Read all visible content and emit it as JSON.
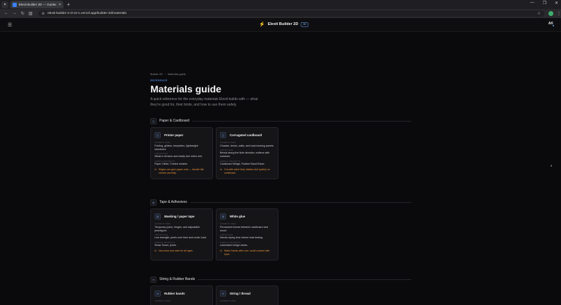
{
  "browser": {
    "tab_title": "Elexit Builder 2D — Guided B...",
    "url": "elexit-builder-2-d-v3-1.vercel.app/builder-2d/materials"
  },
  "header": {
    "app_name": "Elexit Builder 2D",
    "badge": "2D",
    "avatar": "AK"
  },
  "breadcrumb": {
    "root": "Builder 2D",
    "sep": "›",
    "current": "Materials guide"
  },
  "eyebrow": "REFERENCE",
  "title": "Materials guide",
  "lead": "A quick reference for the everyday materials Elexit builds with — what they're good for, their limits, and how to use them safely.",
  "labels": {
    "common_uses": "COMMON USES",
    "limitations": "LIMITATIONS",
    "sample_projects": "SAMPLE PROJECTS"
  },
  "sections": [
    {
      "title": "Paper & Cardboard",
      "cards": [
        {
          "title": "Printer paper",
          "uses": "Folding, gliders, templates, lightweight structures.",
          "limits": "Weak in tension and easily torn when wet.",
          "projects": "Paper Glider, Folded models.",
          "warning": "Edges can give paper cuts — handle flat sheets carefully."
        },
        {
          "title": "Corrugated cardboard",
          "uses": "Chassis, decks, walls, and load-bearing panels.",
          "limits": "Bends along the flute direction; softens with moisture.",
          "projects": "Cardboard Bridge, Rubber Band Racer.",
          "warning": "Cut with adult help; blades dull quickly on cardboard."
        }
      ]
    },
    {
      "title": "Tape & Adhesives",
      "cards": [
        {
          "title": "Masking / paper tape",
          "uses": "Temporary joins, hinges, and adjustable prototypes.",
          "limits": "Low strength; peels over time and under load.",
          "projects": "Straw Tower, joints.",
          "warning": "Non-toxic and safe for all ages."
        },
        {
          "title": "White glue",
          "uses": "Permanent bonds between cardboard and wood.",
          "limits": "Needs drying time before load testing.",
          "projects": "Laminated bridge decks.",
          "warning": "Wash hands after use; avoid contact with eyes."
        }
      ]
    },
    {
      "title": "String & Rubber Bands",
      "cards": [
        {
          "title": "Rubber bands"
        },
        {
          "title": "String / thread"
        }
      ]
    }
  ]
}
